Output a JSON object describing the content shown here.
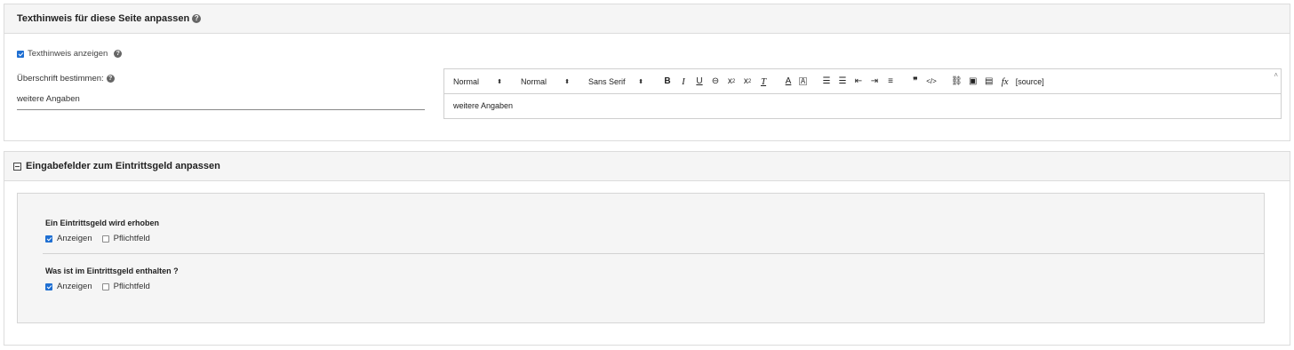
{
  "text_panel": {
    "title": "Texthinweis für diese Seite anpassen",
    "show_label": "Texthinweis anzeigen",
    "heading_label": "Überschrift bestimmen:",
    "heading_value": "weitere Angaben",
    "editor": {
      "select_header": "Normal",
      "select_size": "Normal",
      "select_font": "Sans Serif",
      "source_label": "[source]",
      "body_text": "weitere Angaben"
    }
  },
  "fee_panel": {
    "title": "Eingabefelder zum Eintrittsgeld anpassen",
    "questions": [
      {
        "label": "Ein Eintrittsgeld wird erhoben",
        "show": "Anzeigen",
        "required": "Pflichtfeld"
      },
      {
        "label": "Was ist im Eintrittsgeld enthalten ?",
        "show": "Anzeigen",
        "required": "Pflichtfeld"
      }
    ]
  },
  "colors": {
    "accent": "#1f6fd2",
    "panel_header_bg": "#f5f5f5",
    "border": "#dcdcdc"
  },
  "icons": [
    "help-icon",
    "checkbox-icon",
    "collapse-icon",
    "bold-icon",
    "italic-icon",
    "underline-icon",
    "strike-icon",
    "subscript-icon",
    "superscript-icon",
    "clear-format-icon",
    "text-color-icon",
    "background-color-icon",
    "ordered-list-icon",
    "bullet-list-icon",
    "outdent-icon",
    "indent-icon",
    "align-icon",
    "blockquote-icon",
    "code-icon",
    "link-icon",
    "image-icon",
    "video-icon",
    "formula-icon"
  ]
}
